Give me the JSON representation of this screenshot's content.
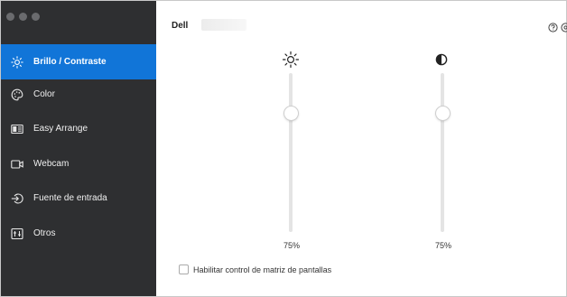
{
  "sidebar": {
    "items": [
      {
        "label": "Brillo / Contraste",
        "icon": "brightness-icon",
        "active": true
      },
      {
        "label": "Color",
        "icon": "palette-icon",
        "active": false
      },
      {
        "label": "Easy Arrange",
        "icon": "layout-icon",
        "active": false
      },
      {
        "label": "Webcam",
        "icon": "webcam-icon",
        "active": false
      },
      {
        "label": "Fuente de entrada",
        "icon": "input-source-icon",
        "active": false
      },
      {
        "label": "Otros",
        "icon": "others-icon",
        "active": false
      }
    ]
  },
  "header": {
    "device_name": "Dell"
  },
  "sliders": {
    "brightness": {
      "value_label": "75%",
      "value": 75
    },
    "contrast": {
      "value_label": "75%",
      "value": 75
    }
  },
  "matrix_option": {
    "label": "Habilitar control de matriz de pantallas",
    "checked": false
  },
  "colors": {
    "sidebar_bg": "#2e2f31",
    "accent": "#1175d8"
  }
}
